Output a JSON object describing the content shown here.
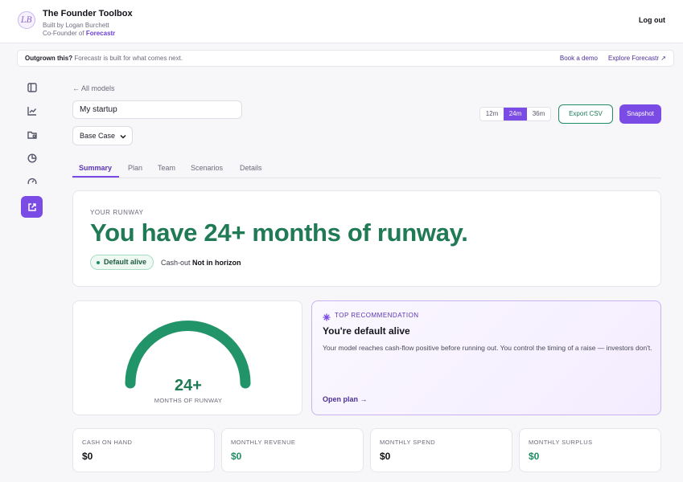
{
  "header": {
    "logo_text": "LB",
    "title": "The Founder Toolbox",
    "subtitle": "Built by Logan Burchett",
    "cofounder_prefix": "Co-Founder of",
    "cofounder_brand": "Forecastr",
    "logout": "Log out"
  },
  "banner": {
    "lead": "Outgrown this?",
    "text": "Forecastr is built for what comes next.",
    "link_demo": "Book a demo",
    "link_explore": "Explore Forecastr ↗"
  },
  "sidebar": {
    "items": [
      {
        "icon": "panel-icon"
      },
      {
        "icon": "chart-icon"
      },
      {
        "icon": "folder-icon"
      },
      {
        "icon": "pie-icon"
      },
      {
        "icon": "gauge-icon"
      },
      {
        "icon": "external-link-icon",
        "active": true
      }
    ]
  },
  "main": {
    "back_link": "← All models",
    "model_name": "My startup",
    "case_select": "Base Case",
    "horizons": [
      "12m",
      "24m",
      "36m"
    ],
    "horizon_selected": "24m",
    "export_label": "Export CSV",
    "snapshot_label": "Snapshot",
    "tabs": [
      "Summary",
      "Plan",
      "Team",
      "Scenarios",
      "Details"
    ],
    "active_tab": "Summary"
  },
  "runway": {
    "eyebrow": "YOUR RUNWAY",
    "headline": "You have 24+ months of runway.",
    "status_pill": "Default alive",
    "cashout_label": "Cash-out",
    "cashout_value": "Not in horizon"
  },
  "gauge": {
    "value": "24+",
    "label": "MONTHS OF RUNWAY",
    "fill_fraction": 1.0,
    "color": "#22946a"
  },
  "recommendation": {
    "eyebrow": "TOP RECOMMENDATION",
    "title": "You're default alive",
    "body": "Your model reaches cash-flow positive before running out. You control the timing of a raise — investors don't.",
    "link": "Open plan →"
  },
  "stats": [
    {
      "label": "CASH ON HAND",
      "value": "$0",
      "color": "#111118"
    },
    {
      "label": "MONTHLY REVENUE",
      "value": "$0",
      "color": "#1f8d63"
    },
    {
      "label": "MONTHLY SPEND",
      "value": "$0",
      "color": "#111118"
    },
    {
      "label": "MONTHLY SURPLUS",
      "value": "$0",
      "color": "#1f8d63"
    }
  ],
  "colors": {
    "accent": "#7b4be6",
    "success": "#1f7a55",
    "background": "#f7f7fa"
  }
}
